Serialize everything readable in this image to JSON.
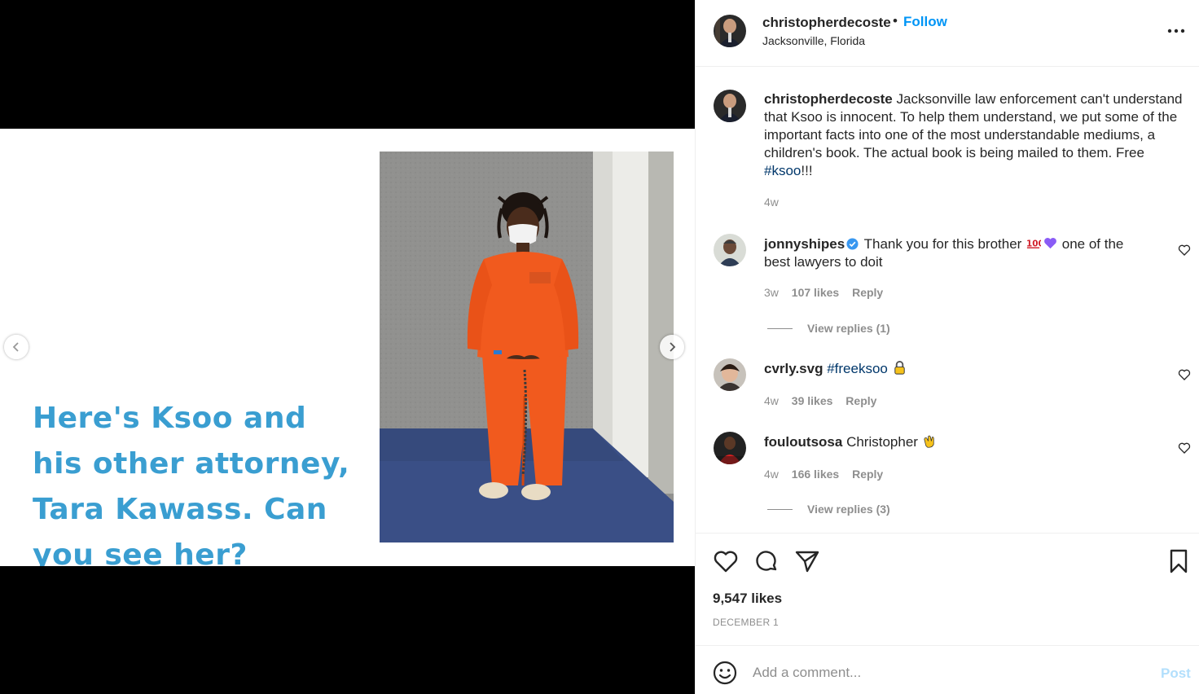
{
  "post": {
    "username": "christopherdecoste",
    "follow_label": "Follow",
    "dot": "•",
    "location": "Jacksonville, Florida"
  },
  "slide": {
    "text": "Here's Ksoo and his other attorney, Tara Kawass. Can you see her?"
  },
  "caption": {
    "username": "christopherdecoste",
    "text": "Jacksonville law enforcement can't understand that Ksoo is innocent. To help them understand, we put some of the important facts into one of the most understandable mediums, a children's book. The actual book is being mailed to them. Free ",
    "hashtag": "#ksoo",
    "suffix": "!!!",
    "time": "4w"
  },
  "comments": [
    {
      "username": "jonnyshipes",
      "text_a": " Thank you for this brother ",
      "text_b": " one of the best lawyers to doit",
      "time": "3w",
      "likes": "107 likes",
      "reply": "Reply",
      "view_replies": "View replies (1)",
      "emojis": [
        "hundred-points-emoji",
        "purple-heart-emoji"
      ]
    },
    {
      "username": "cvrly.svg",
      "hashtag": "#freeksoo",
      "time": "4w",
      "likes": "39 likes",
      "reply": "Reply",
      "emojis": [
        "lock-emoji"
      ]
    },
    {
      "username": "fouloutsosa",
      "text": " Christopher ",
      "time": "4w",
      "likes": "166 likes",
      "reply": "Reply",
      "view_replies": "View replies (3)",
      "emojis": [
        "clapping-hands-emoji"
      ]
    }
  ],
  "actions": {
    "likes": "9,547 likes",
    "date": "DECEMBER 1"
  },
  "composer": {
    "placeholder": "Add a comment...",
    "post_label": "Post"
  },
  "colors": {
    "accent": "#0095f6",
    "slide_text": "#3a9ed1",
    "jumpsuit": "#f15a1e",
    "muted": "#8e8e8e"
  }
}
